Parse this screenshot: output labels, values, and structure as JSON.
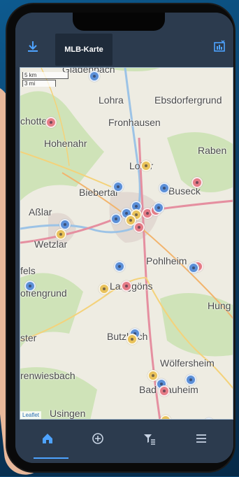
{
  "header": {
    "title": "MLB-Karte",
    "download_icon": "download-icon",
    "chart_icon": "chart-icon"
  },
  "map": {
    "scale_km": "5 km",
    "scale_mi": "3 mi",
    "attribution": "Leaflet",
    "places": [
      {
        "name": "Gladenbach"
      },
      {
        "name": "Lohra"
      },
      {
        "name": "Ebsdorfergrund"
      },
      {
        "name": "chotten"
      },
      {
        "name": "Fronhausen"
      },
      {
        "name": "Hohenahr"
      },
      {
        "name": "Raben"
      },
      {
        "name": "Lollar"
      },
      {
        "name": "Biebertal"
      },
      {
        "name": "Buseck"
      },
      {
        "name": "Aßlar"
      },
      {
        "name": "Wetzlar"
      },
      {
        "name": "Pohlheim"
      },
      {
        "name": "fels"
      },
      {
        "name": "offengrund"
      },
      {
        "name": "Langgöns"
      },
      {
        "name": "Hung"
      },
      {
        "name": "ster"
      },
      {
        "name": "Butzbach"
      },
      {
        "name": "Wölfersheim"
      },
      {
        "name": "renwiesbach"
      },
      {
        "name": "Bad Nauheim"
      },
      {
        "name": "Usingen"
      }
    ]
  },
  "nav": {
    "home_icon": "home-icon",
    "add_icon": "add-circle-icon",
    "filter_icon": "filter-icon",
    "menu_icon": "menu-icon"
  },
  "colors": {
    "accent": "#4ea3ff",
    "bar": "#2c3b4e",
    "marker_blue": "#5b8fd8",
    "marker_red": "#e57b86",
    "marker_yellow": "#e9c25a"
  }
}
